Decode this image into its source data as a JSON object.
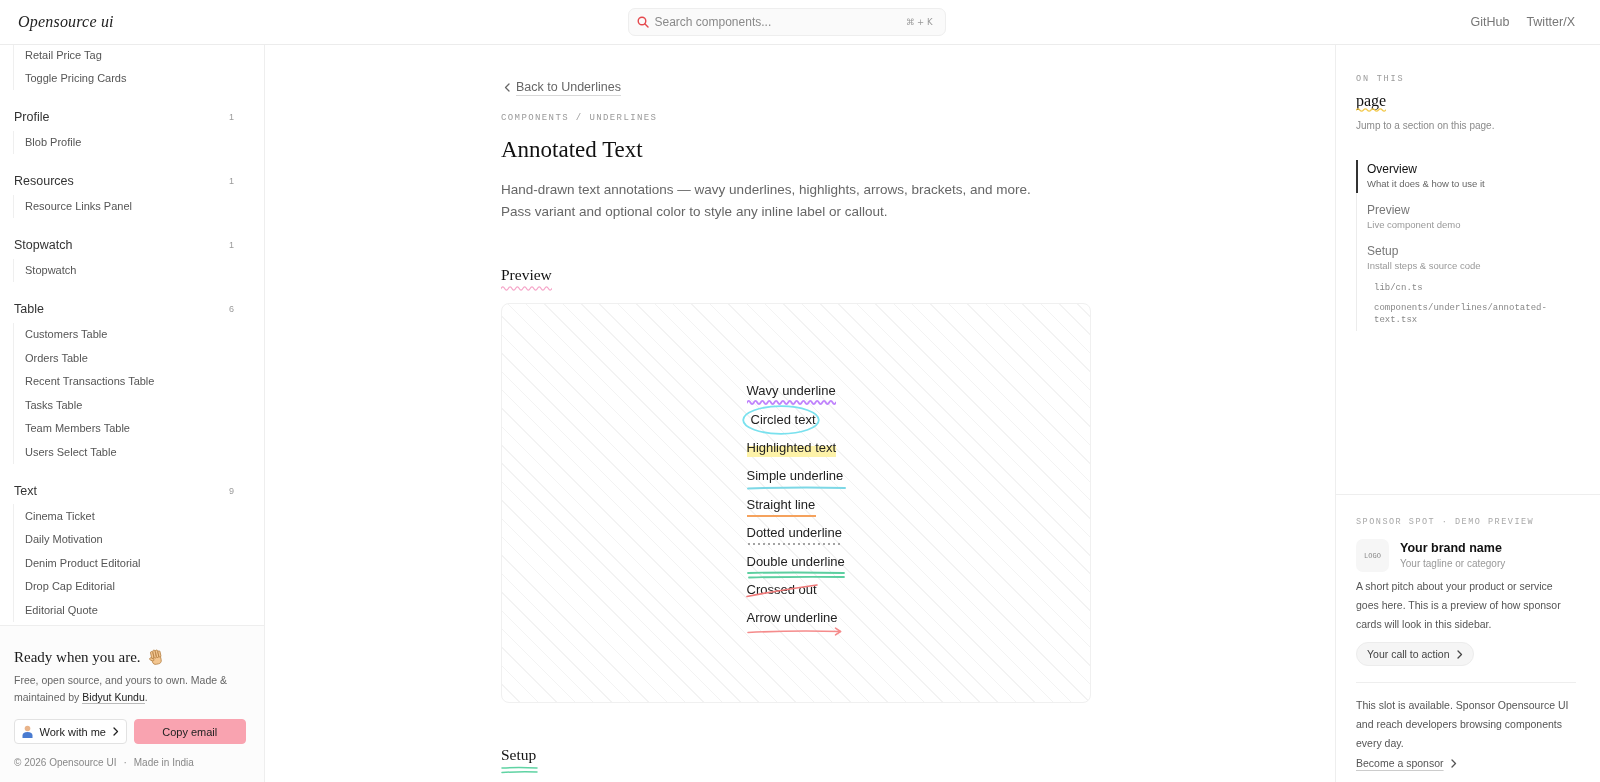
{
  "topbar": {
    "logo": "Opensource ui",
    "search": {
      "placeholder": "Search components...",
      "shortcut": "⌘ + K"
    },
    "links": [
      "GitHub",
      "Twitter/X"
    ]
  },
  "sidebar": {
    "groups": [
      {
        "items": [
          "Retail Price Tag",
          "Toggle Pricing Cards"
        ]
      },
      {
        "label": "Profile",
        "count": "1",
        "items": [
          "Blob Profile"
        ]
      },
      {
        "label": "Resources",
        "count": "1",
        "items": [
          "Resource Links Panel"
        ]
      },
      {
        "label": "Stopwatch",
        "count": "1",
        "items": [
          "Stopwatch"
        ]
      },
      {
        "label": "Table",
        "count": "6",
        "items": [
          "Customers Table",
          "Orders Table",
          "Recent Transactions Table",
          "Tasks Table",
          "Team Members Table",
          "Users Select Table"
        ]
      },
      {
        "label": "Text",
        "count": "9",
        "items": [
          "Cinema Ticket",
          "Daily Motivation",
          "Denim Product Editorial",
          "Drop Cap Editorial",
          "Editorial Quote"
        ]
      }
    ],
    "footer": {
      "heading": "Ready when you are.",
      "blurb": {
        "before": "Free, open source, and yours to own. Made & maintained by ",
        "link": "Bidyut Kundu",
        "after": "."
      },
      "buttons": [
        {
          "label": "Work with me",
          "kind": "secondary"
        },
        {
          "label": "Copy email",
          "kind": "primary"
        }
      ],
      "copyright": "© 2026 Opensource UI",
      "separator": "·",
      "location": "Made in India"
    }
  },
  "main": {
    "back_link": "Back to Underlines",
    "breadcrumb": "COMPONENTS / UNDERLINES",
    "title": "Annotated Text",
    "description": [
      "Hand-drawn text annotations — wavy underlines, highlights, arrows, brackets, and more.",
      "Pass variant and optional color to style any inline label or callout."
    ],
    "preview": {
      "heading": "Preview",
      "items": [
        {
          "text": "Wavy underline",
          "kind": "wavy",
          "color": "#c084fc"
        },
        {
          "text": "Circled text",
          "kind": "circle",
          "color": "#79e1ee"
        },
        {
          "text": "Highlighted text",
          "kind": "highlight",
          "color": "#fdf2a8"
        },
        {
          "text": "Simple underline",
          "kind": "simple",
          "color": "#7dd8e6"
        },
        {
          "text": "Straight line",
          "kind": "straight",
          "color": "#f5a25d"
        },
        {
          "text": "Dotted underline",
          "kind": "dotted",
          "color": "#a3a3a3"
        },
        {
          "text": "Double underline",
          "kind": "double",
          "color": "#5ccfa0"
        },
        {
          "text": "Crossed out",
          "kind": "crossed",
          "color": "#f07a7a"
        },
        {
          "text": "Arrow underline",
          "kind": "arrow",
          "color": "#f58b8b"
        }
      ]
    },
    "setup": {
      "heading": "Setup"
    }
  },
  "toc": {
    "kicker": "ON THIS",
    "title": "page",
    "subtitle": "Jump to a section on this page.",
    "items": [
      {
        "label": "Overview",
        "description": "What it does & how to use it",
        "selected": true
      },
      {
        "label": "Preview",
        "description": "Live component demo",
        "selected": false
      },
      {
        "label": "Setup",
        "description": "Install steps & source code",
        "selected": false,
        "children": [
          {
            "label": "lib/cn.ts"
          },
          {
            "label": "components/underlines/annotated-text.tsx"
          }
        ]
      }
    ]
  },
  "sponsor": {
    "kicker": "SPONSOR SPOT · DEMO PREVIEW",
    "logo": "LOGO",
    "brand": "Your brand name",
    "tagline": "Your tagline or category",
    "pitch": "A short pitch about your product or service goes here. This is a preview of how sponsor cards will look in this sidebar.",
    "cta": "Your call to action",
    "note": "This slot is available. Sponsor Opensource UI and reach developers browsing components every day.",
    "link": "Become a sponsor"
  }
}
